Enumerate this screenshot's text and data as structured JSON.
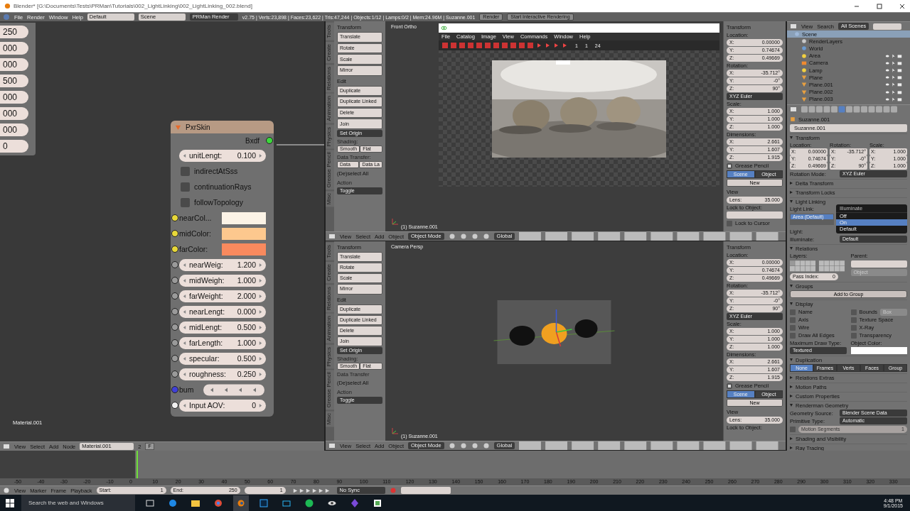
{
  "title_bar": {
    "title": "Blender* [G:\\Documents\\Tests\\PRMan\\Tutorials\\002_LightLinking\\002_LightLinking_002.blend]"
  },
  "info_header": {
    "menus": [
      "File",
      "Render",
      "Window",
      "Help"
    ],
    "layout": "Default",
    "scene": "Scene",
    "engine": "PRMan Render",
    "stats": "v2.75 | Verts:23,898 | Faces:23,622 | Tris:47,244 | Objects:1/12 | Lamps:0/2 | Mem:24.96M | Suzanne.001",
    "buttons": [
      "Render",
      "Start Interactive Rendering"
    ]
  },
  "node_editor": {
    "side_values": [
      "250",
      "000",
      "000",
      "500",
      "000",
      "000",
      "000",
      "0"
    ],
    "node": {
      "title": "PxrSkin",
      "output": "Bxdf",
      "inputs": [
        {
          "kind": "slider",
          "label": "unitLengt:",
          "value": "0.100"
        },
        {
          "kind": "toggle",
          "label": "indirectAtSss",
          "checked": false
        },
        {
          "kind": "toggle",
          "label": "continuationRays",
          "checked": false
        },
        {
          "kind": "toggle",
          "label": "followTopology",
          "checked": false
        },
        {
          "kind": "color",
          "label": "nearCol...",
          "color": "#fbf3e6"
        },
        {
          "kind": "color",
          "label": "midColor:",
          "color": "#fdc88e"
        },
        {
          "kind": "color",
          "label": "farColor:",
          "color": "#f98a5e"
        },
        {
          "kind": "float",
          "label": "nearWeig:",
          "value": "1.200"
        },
        {
          "kind": "float",
          "label": "midWeigh:",
          "value": "1.000"
        },
        {
          "kind": "float",
          "label": "farWeight:",
          "value": "2.000"
        },
        {
          "kind": "float",
          "label": "nearLengt:",
          "value": "0.000"
        },
        {
          "kind": "float",
          "label": "midLengt:",
          "value": "0.500"
        },
        {
          "kind": "float",
          "label": "farLength:",
          "value": "1.000"
        },
        {
          "kind": "float",
          "label": "specular:",
          "value": "0.500"
        },
        {
          "kind": "float",
          "label": "roughness:",
          "value": "0.250"
        },
        {
          "kind": "bump",
          "label": "bum"
        },
        {
          "kind": "aov",
          "label": "Input AOV:",
          "value": "0"
        }
      ]
    },
    "material_label": "Material.001",
    "header": {
      "menus": [
        "View",
        "Select",
        "Add",
        "Node"
      ],
      "material": "Material.001",
      "users": "2",
      "fake": "F"
    }
  },
  "views": [
    {
      "kind": "render",
      "tabs": [
        "Tools",
        "Create",
        "Relations",
        "Animation",
        "Physics",
        "Grease Pencil",
        "Misc"
      ],
      "shelf": [
        {
          "kind": "heading",
          "text": "Transform"
        },
        {
          "kind": "button",
          "text": "Translate"
        },
        {
          "kind": "button",
          "text": "Rotate"
        },
        {
          "kind": "button",
          "text": "Scale"
        },
        {
          "kind": "button",
          "text": "Mirror"
        },
        {
          "kind": "heading",
          "text": "Edit"
        },
        {
          "kind": "button",
          "text": "Duplicate"
        },
        {
          "kind": "button",
          "text": "Duplicate Linked"
        },
        {
          "kind": "button",
          "text": "Delete"
        },
        {
          "kind": "button",
          "text": "Join"
        },
        {
          "kind": "dropdown",
          "text": "Set Origin"
        },
        {
          "kind": "label",
          "text": "Shading:"
        },
        {
          "kind": "pair",
          "items": [
            "Smooth",
            "Flat"
          ]
        },
        {
          "kind": "label",
          "text": "Data Transfer:"
        },
        {
          "kind": "pair",
          "items": [
            "Data",
            "Data La"
          ]
        }
      ],
      "operator": {
        "title": "(De)select All",
        "label": "Action",
        "value": "Toggle"
      },
      "label": "Front Ortho",
      "object_label": "(1) Suzanne.001",
      "render_window": {
        "menus": [
          "File",
          "Catalog",
          "Image",
          "View",
          "Commands",
          "Window",
          "Help"
        ],
        "frames": [
          "1",
          "1",
          "24"
        ]
      },
      "header": {
        "menus": [
          "View",
          "Select",
          "Add",
          "Object"
        ],
        "mode": "Object Mode",
        "orientation": "Global"
      },
      "npanel": [
        {
          "kind": "heading",
          "text": "Transform"
        },
        {
          "kind": "label",
          "text": "Location:"
        },
        {
          "kind": "field",
          "label": "X:",
          "value": "0.00000"
        },
        {
          "kind": "field",
          "label": "Y:",
          "value": "0.74674"
        },
        {
          "kind": "field",
          "label": "Z:",
          "value": "0.49669"
        },
        {
          "kind": "label",
          "text": "Rotation:"
        },
        {
          "kind": "field",
          "label": "X:",
          "value": "-35.712°"
        },
        {
          "kind": "field",
          "label": "Y:",
          "value": "-0°"
        },
        {
          "kind": "field",
          "label": "Z:",
          "value": "90°"
        },
        {
          "kind": "dropdown",
          "text": "XYZ Euler"
        },
        {
          "kind": "label",
          "text": "Scale:"
        },
        {
          "kind": "field",
          "label": "X:",
          "value": "1.000"
        },
        {
          "kind": "field",
          "label": "Y:",
          "value": "1.000"
        },
        {
          "kind": "field",
          "label": "Z:",
          "value": "1.000"
        },
        {
          "kind": "label",
          "text": "Dimensions:"
        },
        {
          "kind": "field",
          "label": "X:",
          "value": "2.661"
        },
        {
          "kind": "field",
          "label": "Y:",
          "value": "1.607"
        },
        {
          "kind": "field",
          "label": "Z:",
          "value": "1.915"
        },
        {
          "kind": "check_heading",
          "text": "Grease Pencil",
          "checked": true
        },
        {
          "kind": "tabs",
          "items": [
            {
              "text": "Scene",
              "selected": true
            },
            {
              "text": "Object",
              "selected": false
            }
          ]
        },
        {
          "kind": "new",
          "text": "New"
        },
        {
          "kind": "heading",
          "text": "View"
        },
        {
          "kind": "field",
          "label": "Lens:",
          "value": "35.000"
        },
        {
          "kind": "label",
          "text": "Lock to Object:"
        },
        {
          "kind": "objfield"
        },
        {
          "kind": "check",
          "text": "Lock to Cursor",
          "checked": false
        }
      ]
    },
    {
      "kind": "camera",
      "tabs": [
        "Tools",
        "Create",
        "Relations",
        "Animation",
        "Physics",
        "Grease Pencil",
        "Misc"
      ],
      "shelf": [
        {
          "kind": "heading",
          "text": "Transform"
        },
        {
          "kind": "button",
          "text": "Translate"
        },
        {
          "kind": "button",
          "text": "Rotate"
        },
        {
          "kind": "button",
          "text": "Scale"
        },
        {
          "kind": "button",
          "text": "Mirror"
        },
        {
          "kind": "heading",
          "text": "Edit"
        },
        {
          "kind": "button",
          "text": "Duplicate"
        },
        {
          "kind": "button",
          "text": "Duplicate Linked"
        },
        {
          "kind": "button",
          "text": "Delete"
        },
        {
          "kind": "button",
          "text": "Join"
        },
        {
          "kind": "dropdown",
          "text": "Set Origin"
        },
        {
          "kind": "label",
          "text": "Shading:"
        },
        {
          "kind": "pair",
          "items": [
            "Smooth",
            "Flat"
          ]
        },
        {
          "kind": "label",
          "text": "Data Transfer"
        }
      ],
      "operator": {
        "title": "(De)select All",
        "label": "Action",
        "value": "Toggle"
      },
      "label": "Camera Persp",
      "object_label": "(1) Suzanne.001",
      "header": {
        "menus": [
          "View",
          "Select",
          "Add",
          "Object"
        ],
        "mode": "Object Mode",
        "orientation": "Global"
      },
      "npanel": [
        {
          "kind": "heading",
          "text": "Transform"
        },
        {
          "kind": "label",
          "text": "Location:"
        },
        {
          "kind": "field",
          "label": "X:",
          "value": "0.00000"
        },
        {
          "kind": "field",
          "label": "Y:",
          "value": "0.74674"
        },
        {
          "kind": "field",
          "label": "Z:",
          "value": "0.49669"
        },
        {
          "kind": "label",
          "text": "Rotation:"
        },
        {
          "kind": "field",
          "label": "X:",
          "value": "-35.712°"
        },
        {
          "kind": "field",
          "label": "Y:",
          "value": "-0°"
        },
        {
          "kind": "field",
          "label": "Z:",
          "value": "90°"
        },
        {
          "kind": "dropdown",
          "text": "XYZ Euler"
        },
        {
          "kind": "label",
          "text": "Scale:"
        },
        {
          "kind": "field",
          "label": "X:",
          "value": "1.000"
        },
        {
          "kind": "field",
          "label": "Y:",
          "value": "1.000"
        },
        {
          "kind": "field",
          "label": "Z:",
          "value": "1.000"
        },
        {
          "kind": "label",
          "text": "Dimensions:"
        },
        {
          "kind": "field",
          "label": "X:",
          "value": "2.661"
        },
        {
          "kind": "field",
          "label": "Y:",
          "value": "1.607"
        },
        {
          "kind": "field",
          "label": "Z:",
          "value": "1.915"
        },
        {
          "kind": "check_heading",
          "text": "Grease Pencil",
          "checked": true
        },
        {
          "kind": "tabs",
          "items": [
            {
              "text": "Scene",
              "selected": true
            },
            {
              "text": "Object",
              "selected": false
            }
          ]
        },
        {
          "kind": "new",
          "text": "New"
        },
        {
          "kind": "heading",
          "text": "View"
        },
        {
          "kind": "field",
          "label": "Lens:",
          "value": "35.000"
        },
        {
          "kind": "label",
          "text": "Lock to Object:"
        }
      ]
    }
  ],
  "outliner": {
    "menus": [
      "View",
      "Search"
    ],
    "filter": "All Scenes",
    "tree": {
      "text": "Scene",
      "kind": "scene",
      "selected": true,
      "children": [
        {
          "text": "RenderLayers",
          "kind": "layers",
          "selected": false
        },
        {
          "text": "World",
          "kind": "world",
          "selected": false
        },
        {
          "text": "Area",
          "kind": "lamp",
          "selected": false
        },
        {
          "text": "Camera",
          "kind": "camera",
          "selected": false
        },
        {
          "text": "Lamp",
          "kind": "lamp",
          "selected": false
        },
        {
          "text": "Plane",
          "kind": "mesh",
          "selected": false
        },
        {
          "text": "Plane.001",
          "kind": "mesh",
          "selected": false
        },
        {
          "text": "Plane.002",
          "kind": "mesh",
          "selected": false
        },
        {
          "text": "Plane.003",
          "kind": "mesh",
          "selected": false
        }
      ]
    }
  },
  "properties": {
    "object": "Suzanne.001",
    "name": "Suzanne.001",
    "panels": [
      {
        "title": "Transform",
        "expanded": true,
        "rows": [
          {
            "kind": "xyz3",
            "columns": [
              {
                "label": "Location:",
                "fields": [
                  {
                    "label": "X:",
                    "value": "0.00000"
                  },
                  {
                    "label": "Y:",
                    "value": "0.74674"
                  },
                  {
                    "label": "Z:",
                    "value": "0.49669"
                  }
                ]
              },
              {
                "label": "Rotation:",
                "fields": [
                  {
                    "label": "X:",
                    "value": "-35.712°"
                  },
                  {
                    "label": "Y:",
                    "value": "-0°"
                  },
                  {
                    "label": "Z:",
                    "value": "90°"
                  }
                ]
              },
              {
                "label": "Scale:",
                "fields": [
                  {
                    "label": "X:",
                    "value": "1.000"
                  },
                  {
                    "label": "Y:",
                    "value": "1.000"
                  },
                  {
                    "label": "Z:",
                    "value": "1.000"
                  }
                ]
              }
            ]
          },
          {
            "kind": "prop",
            "label": "Rotation Mode:",
            "value": "XYZ Euler"
          }
        ]
      },
      {
        "title": "Delta Transform",
        "expanded": false
      },
      {
        "title": "Transform Locks",
        "expanded": false
      },
      {
        "title": "Light Linking",
        "expanded": true,
        "rows": [
          {
            "kind": "lightlink",
            "label": "Light Link:",
            "items": [
              {
                "text": "Area (Default)",
                "selected": true
              }
            ],
            "menu": {
              "title": "Illuminate",
              "options": [
                {
                  "text": "Off",
                  "selected": false
                },
                {
                  "text": "On",
                  "selected": true
                },
                {
                  "text": "Default",
                  "selected": false
                }
              ]
            }
          },
          {
            "kind": "prop",
            "label": "Light:"
          },
          {
            "kind": "prop",
            "label": "Illuminate:",
            "value": "Default"
          }
        ]
      },
      {
        "title": "Relations",
        "expanded": true,
        "rows": [
          {
            "kind": "relations",
            "layers_label": "Layers:",
            "parent_label": "Parent:",
            "parent_type": "Object",
            "pass_label": "Pass Index:",
            "pass_value": "0"
          }
        ]
      },
      {
        "title": "Groups",
        "expanded": true,
        "rows": [
          {
            "kind": "button",
            "text": "Add to Group"
          }
        ]
      },
      {
        "title": "Display",
        "expanded": true,
        "rows": [
          {
            "kind": "checks",
            "items": [
              {
                "text": "Name",
                "checked": false
              },
              {
                "text": "Bounds",
                "checked": false,
                "value": "Box"
              },
              {
                "text": "Axis",
                "checked": false
              },
              {
                "text": "Texture Space",
                "checked": false
              },
              {
                "text": "Wire",
                "checked": false
              },
              {
                "text": "X-Ray",
                "checked": false
              },
              {
                "text": "Draw All Edges",
                "checked": false
              },
              {
                "text": "Transparency",
                "checked": false
              }
            ]
          },
          {
            "kind": "drawtype",
            "labels": [
              "Maximum Draw Type:",
              "Object Color:"
            ],
            "value": "Textured"
          }
        ]
      },
      {
        "title": "Duplication",
        "expanded": true,
        "rows": [
          {
            "kind": "seg",
            "items": [
              {
                "text": "None",
                "selected": true
              },
              {
                "text": "Frames",
                "selected": false
              },
              {
                "text": "Verts",
                "selected": false
              },
              {
                "text": "Faces",
                "selected": false
              },
              {
                "text": "Group",
                "selected": false
              }
            ]
          }
        ]
      },
      {
        "title": "Relations Extras",
        "expanded": false
      },
      {
        "title": "Motion Paths",
        "expanded": false
      },
      {
        "title": "Custom Properties",
        "expanded": false
      },
      {
        "title": "Renderman Geometry",
        "expanded": true,
        "rows": [
          {
            "kind": "prop",
            "label": "Geometry Source:",
            "value": "Blender Scene Data"
          },
          {
            "kind": "prop",
            "label": "Primitive Type:",
            "value": "Automatic"
          },
          {
            "kind": "checkfield",
            "checked": false,
            "label": "Motion Segments",
            "value": "1"
          }
        ]
      },
      {
        "title": "Shading and Visibility",
        "expanded": false
      },
      {
        "title": "Ray Tracing",
        "expanded": false
      }
    ]
  },
  "timeline": {
    "ticks": [
      "-50",
      "-40",
      "-30",
      "-20",
      "-10",
      "0",
      "10",
      "20",
      "30",
      "40",
      "50",
      "60",
      "70",
      "80",
      "90",
      "100",
      "110",
      "120",
      "130",
      "140",
      "150",
      "160",
      "170",
      "180",
      "190",
      "200",
      "210",
      "220",
      "230",
      "240",
      "250",
      "260",
      "270",
      "280",
      "290",
      "300",
      "310",
      "320",
      "330"
    ],
    "menus": [
      "View",
      "Marker",
      "Frame",
      "Playback"
    ],
    "start": {
      "label": "Start:",
      "value": "1"
    },
    "end": {
      "label": "End:",
      "value": "250"
    },
    "current": "1",
    "sync": "No Sync"
  },
  "taskbar": {
    "search": "Search the web and Windows",
    "time": "4:48 PM",
    "date": "9/1/2015"
  }
}
